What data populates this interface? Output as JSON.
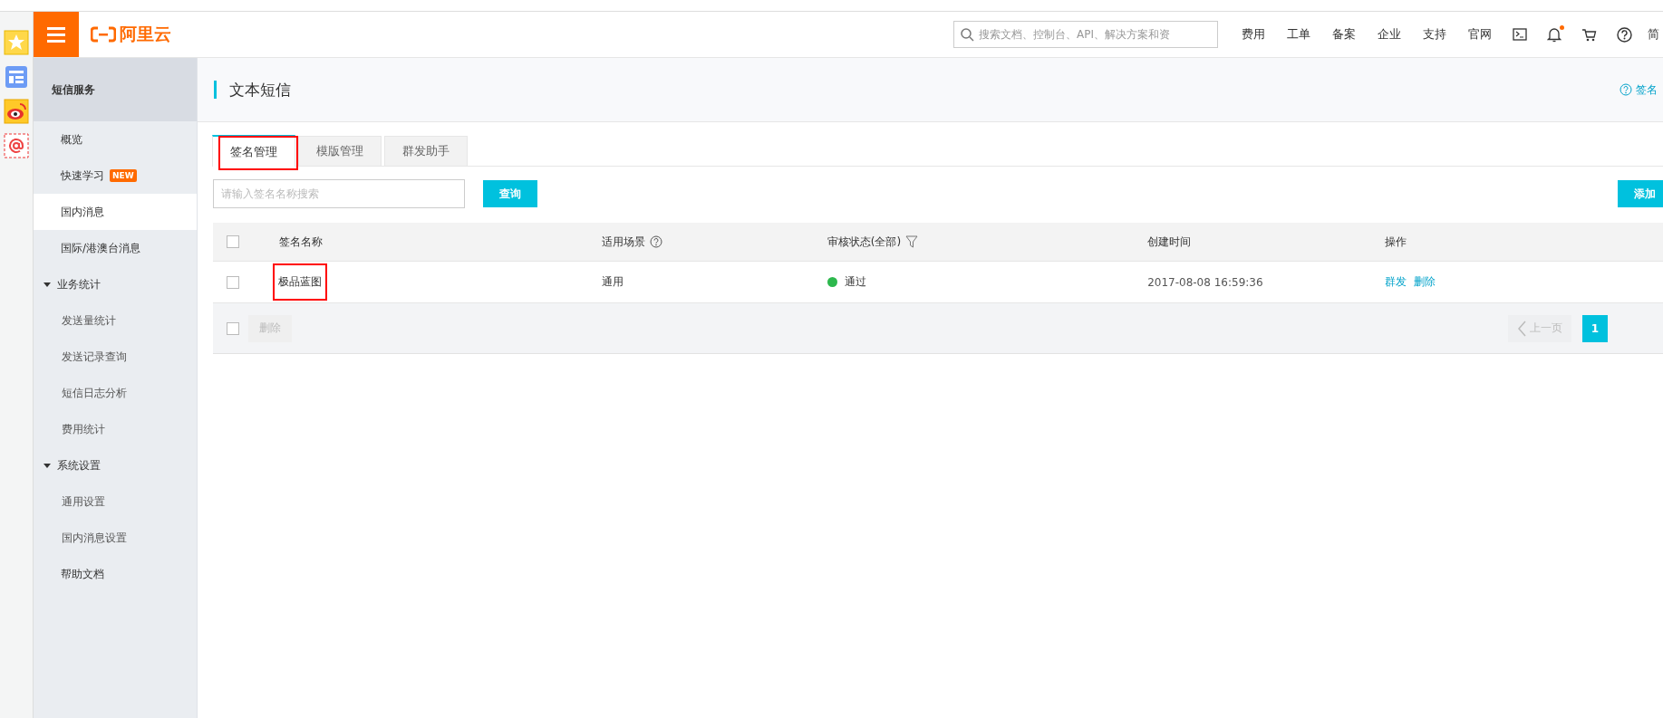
{
  "header": {
    "logo": "阿里云",
    "search": {
      "placeholder": "搜索文档、控制台、API、解决方案和资"
    },
    "nav": [
      "费用",
      "工单",
      "备案",
      "企业",
      "支持",
      "官网"
    ],
    "notification_dot": true,
    "cut_label": "简"
  },
  "sidebar": {
    "title": "短信服务",
    "items": [
      {
        "label": "概览",
        "selected": false
      },
      {
        "label": "快速学习",
        "badge": "NEW",
        "selected": false
      },
      {
        "label": "国内消息",
        "selected": true
      },
      {
        "label": "国际/港澳台消息",
        "selected": false
      },
      {
        "label": "业务统计",
        "selected": false,
        "expanded": true,
        "children": [
          {
            "label": "发送量统计",
            "selected": false
          },
          {
            "label": "发送记录查询",
            "selected": false
          },
          {
            "label": "短信日志分析",
            "selected": false
          },
          {
            "label": "费用统计",
            "selected": false
          }
        ]
      },
      {
        "label": "系统设置",
        "selected": false,
        "expanded": true,
        "children": [
          {
            "label": "通用设置",
            "selected": false
          },
          {
            "label": "国内消息设置",
            "selected": false
          }
        ]
      },
      {
        "label": "帮助文档",
        "selected": false
      }
    ]
  },
  "page": {
    "title": "文本短信",
    "help_link": "签名"
  },
  "tabs": [
    {
      "label": "签名管理",
      "selected": true,
      "highlighted": true
    },
    {
      "label": "模版管理",
      "selected": false,
      "highlighted": false
    },
    {
      "label": "群发助手",
      "selected": false,
      "highlighted": false
    }
  ],
  "search": {
    "placeholder": "请输入签名名称搜索",
    "button": "查询",
    "add_button": "添加"
  },
  "table": {
    "header_checked": false,
    "columns": [
      "签名名称",
      "适用场景",
      "审核状态(全部)",
      "创建时间",
      "操作"
    ],
    "rows": [
      {
        "checked": false,
        "name": "极品蓝图",
        "name_highlighted": true,
        "scene": "通用",
        "status": "通过",
        "color": "#2db84d",
        "created": "2017-08-08 16:59:36",
        "actions": [
          "群发",
          "删除"
        ]
      }
    ],
    "footer": {
      "checked": false,
      "delete_button": "删除",
      "prev": "上一页",
      "pages": [
        {
          "label": "1",
          "selected": true
        }
      ]
    }
  }
}
